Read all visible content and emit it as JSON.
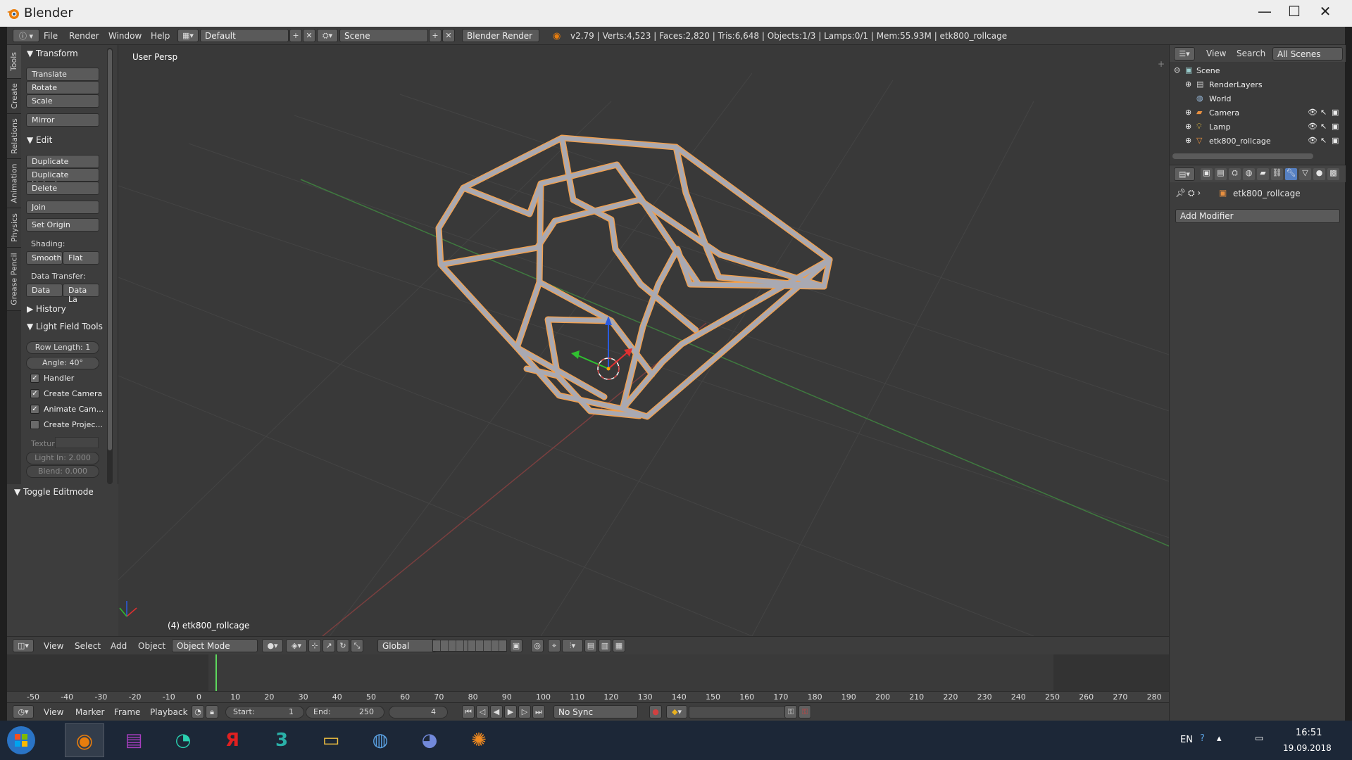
{
  "window": {
    "title": "Blender",
    "controls": [
      "—",
      "☐",
      "✕"
    ]
  },
  "info_header": {
    "menus": [
      "File",
      "Render",
      "Window",
      "Help"
    ],
    "layout": "Default",
    "scene": "Scene",
    "engine": "Blender Render",
    "stats": "v2.79 | Verts:4,523 | Faces:2,820 | Tris:6,648 | Objects:1/3 | Lamps:0/1 | Mem:55.93M | etk800_rollcage"
  },
  "tabs": [
    "Tools",
    "Create",
    "Relations",
    "Animation",
    "Physics",
    "Grease Pencil"
  ],
  "toolshelf": {
    "transform": {
      "header": "Transform",
      "buttons": [
        "Translate",
        "Rotate",
        "Scale",
        "Mirror"
      ]
    },
    "edit": {
      "header": "Edit",
      "buttons": [
        "Duplicate",
        "Duplicate Linked",
        "Delete",
        "Join",
        "Set Origin"
      ],
      "shading_label": "Shading:",
      "smooth": "Smooth",
      "flat": "Flat",
      "data_transfer_label": "Data Transfer:",
      "data": "Data",
      "data_la": "Data La"
    },
    "history": {
      "header": "History"
    },
    "light_field": {
      "header": "Light Field Tools",
      "row_length": "Row Length: 1",
      "angle": "Angle:   40°",
      "checks": [
        {
          "label": "Handler",
          "checked": true
        },
        {
          "label": "Create Camera",
          "checked": true
        },
        {
          "label": "Animate Cam...",
          "checked": true
        },
        {
          "label": "Create Projec...",
          "checked": false
        }
      ],
      "texture": "Textur",
      "light_in": "Light In: 2.000",
      "blend": "Blend:   0.000"
    },
    "toggle_editmode": "Toggle Editmode"
  },
  "viewport": {
    "label": "User Persp",
    "object_label": "(4) etk800_rollcage"
  },
  "view3d_header": {
    "menus": [
      "View",
      "Select",
      "Add",
      "Object"
    ],
    "mode": "Object Mode",
    "orientation": "Global"
  },
  "timeline": {
    "ticks": [
      "-50",
      "-40",
      "-30",
      "-20",
      "-10",
      "0",
      "10",
      "20",
      "30",
      "40",
      "50",
      "60",
      "70",
      "80",
      "90",
      "100",
      "110",
      "120",
      "130",
      "140",
      "150",
      "160",
      "170",
      "180",
      "190",
      "200",
      "210",
      "220",
      "230",
      "240",
      "250",
      "260",
      "270",
      "280"
    ],
    "menus": [
      "View",
      "Marker",
      "Frame",
      "Playback"
    ],
    "start": "Start:",
    "start_val": "1",
    "end": "End:",
    "end_val": "250",
    "current": "4",
    "sync": "No Sync"
  },
  "outliner": {
    "menus": [
      "View",
      "Search"
    ],
    "filter": "All Scenes",
    "rows": [
      "Scene",
      "RenderLayers",
      "World",
      "Camera",
      "Lamp",
      "etk800_rollcage"
    ]
  },
  "properties": {
    "object": "etk800_rollcage",
    "add_modifier": "Add Modifier"
  },
  "taskbar": {
    "lang": "EN",
    "time": "16:51",
    "date": "19.09.2018"
  },
  "colors": {
    "viewport_bg": "#393939",
    "selection_outline": "#f0a050",
    "panel": "#3d3d3d"
  }
}
